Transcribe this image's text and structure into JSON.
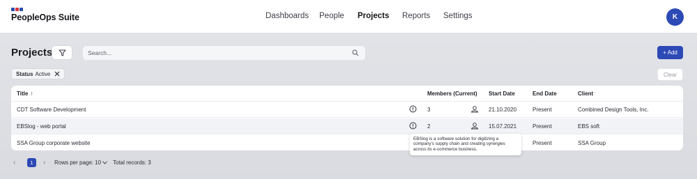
{
  "app": {
    "name": "PeopleOps Suite",
    "brand_colors": [
      "#2b4ba8",
      "#d9363e",
      "#2b4ba8"
    ],
    "accent": "#2d49b6"
  },
  "nav": {
    "items": [
      {
        "label": "Dashboards",
        "active": false
      },
      {
        "label": "People",
        "active": false
      },
      {
        "label": "Projects",
        "active": true
      },
      {
        "label": "Reports",
        "active": false
      },
      {
        "label": "Settings",
        "active": false
      }
    ],
    "avatar_initial": "K"
  },
  "toolbar": {
    "title": "Projects",
    "filter_icon": "funnel-icon",
    "search_placeholder": "Search...",
    "search_value": "",
    "add_label": "+ Add"
  },
  "filters": {
    "chips": [
      {
        "key": "Status",
        "value": "Active"
      }
    ],
    "clear_label": "Clear"
  },
  "table": {
    "columns": {
      "title": "Title",
      "title_sort": "↑",
      "members": "Members (Current)",
      "start": "Start Date",
      "end": "End Date",
      "client": "Client"
    },
    "rows": [
      {
        "title": "CDT Software Development",
        "members": "3",
        "start": "21.10.2020",
        "end": "Present",
        "client": "Combined Design Tools, Inc."
      },
      {
        "title": "EBSlog - web portal",
        "members": "2",
        "start": "15.07.2021",
        "end": "Present",
        "client": "EBS soft"
      },
      {
        "title": "SSA Group corporate website",
        "members": "",
        "start": "",
        "end": "Present",
        "client": "SSA Group"
      }
    ]
  },
  "tooltip": {
    "text": "EBSlog is a software solution for digitizing a company's supply chain and creating synergies across its e-commerce business."
  },
  "pagination": {
    "prev": "‹",
    "page": "1",
    "next": "›",
    "rows_label": "Rows per page:",
    "rows_value": "10",
    "total_label": "Total records: 3"
  }
}
